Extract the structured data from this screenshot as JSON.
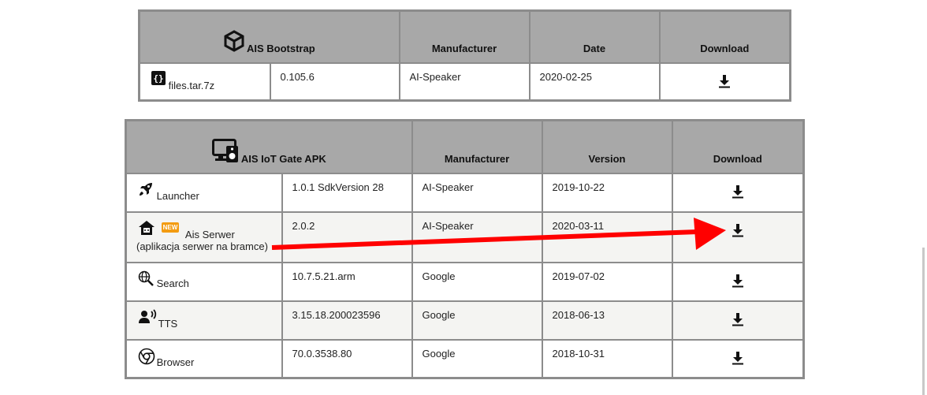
{
  "bootstrap_table": {
    "title": "AIS Bootstrap",
    "col_manufacturer": "Manufacturer",
    "col_date": "Date",
    "col_download": "Download",
    "row": {
      "name": "files.tar.7z",
      "version": "0.105.6",
      "manufacturer": "AI-Speaker",
      "date": "2020-02-25"
    }
  },
  "apk_table": {
    "title": "AIS IoT Gate APK",
    "col_manufacturer": "Manufacturer",
    "col_version": "Version",
    "col_download": "Download",
    "rows": [
      {
        "name": "Launcher",
        "version": "1.0.1 SdkVersion 28",
        "manufacturer": "AI-Speaker",
        "date": "2019-10-22",
        "icon": "rocket-icon"
      },
      {
        "name": "Ais Serwer",
        "subtitle": "(aplikacja serwer na bramce)",
        "badge": "NEW",
        "version": "2.0.2",
        "manufacturer": "AI-Speaker",
        "date": "2020-03-11",
        "icon": "home-server-icon"
      },
      {
        "name": "Search",
        "version": "10.7.5.21.arm",
        "manufacturer": "Google",
        "date": "2019-07-02",
        "icon": "globe-search-icon"
      },
      {
        "name": "TTS",
        "version": "3.15.18.200023596",
        "manufacturer": "Google",
        "date": "2018-06-13",
        "icon": "speaker-voice-icon"
      },
      {
        "name": "Browser",
        "version": "70.0.3538.80",
        "manufacturer": "Google",
        "date": "2018-10-31",
        "icon": "chrome-icon"
      }
    ]
  },
  "annotation": {
    "color": "#ff0000"
  }
}
